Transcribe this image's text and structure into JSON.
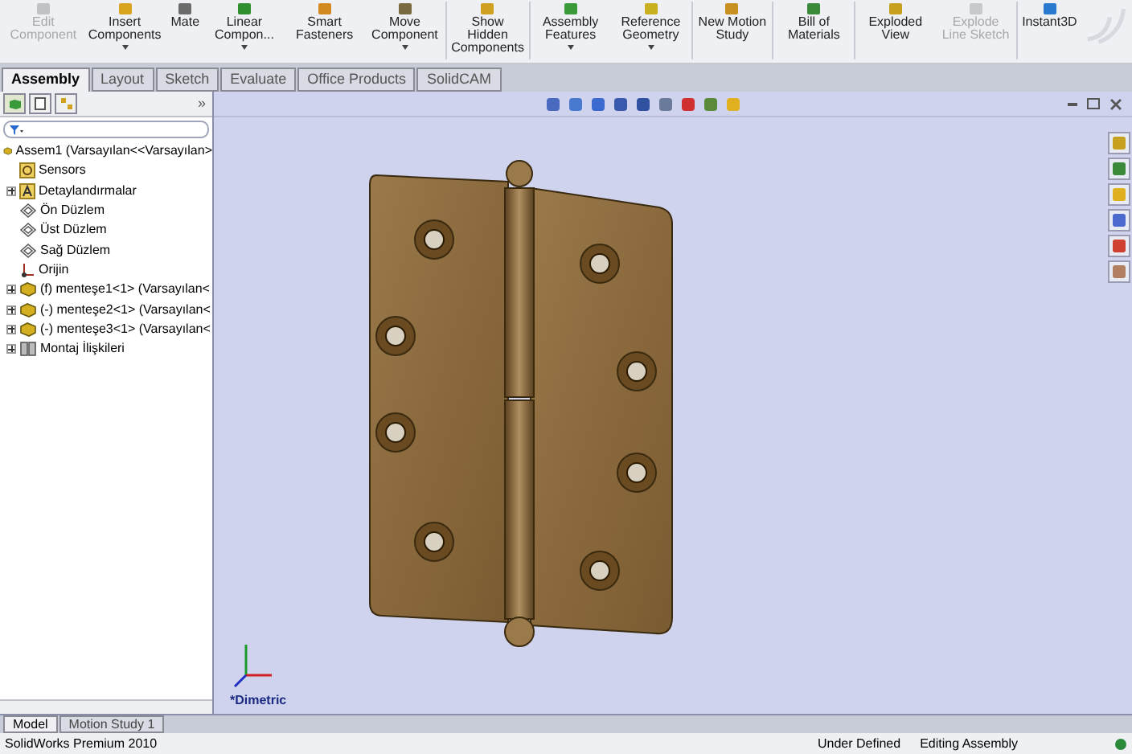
{
  "toolbar": {
    "buttons": [
      {
        "label": "Edit Component",
        "disabled": true,
        "dropdown": false,
        "separator_after": false
      },
      {
        "label": "Insert Components",
        "disabled": false,
        "dropdown": true,
        "separator_after": false
      },
      {
        "label": "Mate",
        "disabled": false,
        "dropdown": false,
        "separator_after": false
      },
      {
        "label": "Linear Compon...",
        "disabled": false,
        "dropdown": true,
        "separator_after": false
      },
      {
        "label": "Smart Fasteners",
        "disabled": false,
        "dropdown": false,
        "separator_after": false
      },
      {
        "label": "Move Component",
        "disabled": false,
        "dropdown": true,
        "separator_after": true
      },
      {
        "label": "Show Hidden Components",
        "disabled": false,
        "dropdown": false,
        "separator_after": true
      },
      {
        "label": "Assembly Features",
        "disabled": false,
        "dropdown": true,
        "separator_after": false
      },
      {
        "label": "Reference Geometry",
        "disabled": false,
        "dropdown": true,
        "separator_after": true
      },
      {
        "label": "New Motion Study",
        "disabled": false,
        "dropdown": false,
        "separator_after": true
      },
      {
        "label": "Bill of Materials",
        "disabled": false,
        "dropdown": false,
        "separator_after": true
      },
      {
        "label": "Exploded View",
        "disabled": false,
        "dropdown": false,
        "separator_after": false
      },
      {
        "label": "Explode Line Sketch",
        "disabled": true,
        "dropdown": false,
        "separator_after": true
      },
      {
        "label": "Instant3D",
        "disabled": false,
        "dropdown": false,
        "separator_after": false
      }
    ]
  },
  "tabs": [
    {
      "label": "Assembly",
      "selected": true
    },
    {
      "label": "Layout",
      "selected": false
    },
    {
      "label": "Sketch",
      "selected": false
    },
    {
      "label": "Evaluate",
      "selected": false
    },
    {
      "label": "Office Products",
      "selected": false
    },
    {
      "label": "SolidCAM",
      "selected": false
    }
  ],
  "feature_tree": {
    "expand_all": "»",
    "root": {
      "kind": "assembly",
      "label": "Assem1  (Varsayılan<<Varsayılan>",
      "children": [
        {
          "kind": "sensor",
          "label": "Sensors",
          "expandable": false
        },
        {
          "kind": "annotation",
          "label": "Detaylandırmalar",
          "expandable": true
        },
        {
          "kind": "plane",
          "label": "Ön Düzlem",
          "expandable": false
        },
        {
          "kind": "plane",
          "label": "Üst Düzlem",
          "expandable": false
        },
        {
          "kind": "plane",
          "label": "Sağ Düzlem",
          "expandable": false
        },
        {
          "kind": "origin",
          "label": "Orijin",
          "expandable": false
        },
        {
          "kind": "part",
          "label": "(f) menteşe1<1> (Varsayılan<",
          "expandable": true
        },
        {
          "kind": "part",
          "label": "(-) menteşe2<1> (Varsayılan<",
          "expandable": true
        },
        {
          "kind": "part",
          "label": "(-) menteşe3<1> (Varsayılan<",
          "expandable": true
        },
        {
          "kind": "mates",
          "label": "Montaj İlişkileri",
          "expandable": true
        }
      ]
    }
  },
  "viewport": {
    "view_label": "*Dimetric"
  },
  "bottom_tabs": [
    {
      "label": "Model",
      "selected": true
    },
    {
      "label": "Motion Study 1",
      "selected": false
    }
  ],
  "status_bar": {
    "product": "SolidWorks Premium 2010",
    "state": "Under Defined",
    "mode": "Editing Assembly"
  }
}
